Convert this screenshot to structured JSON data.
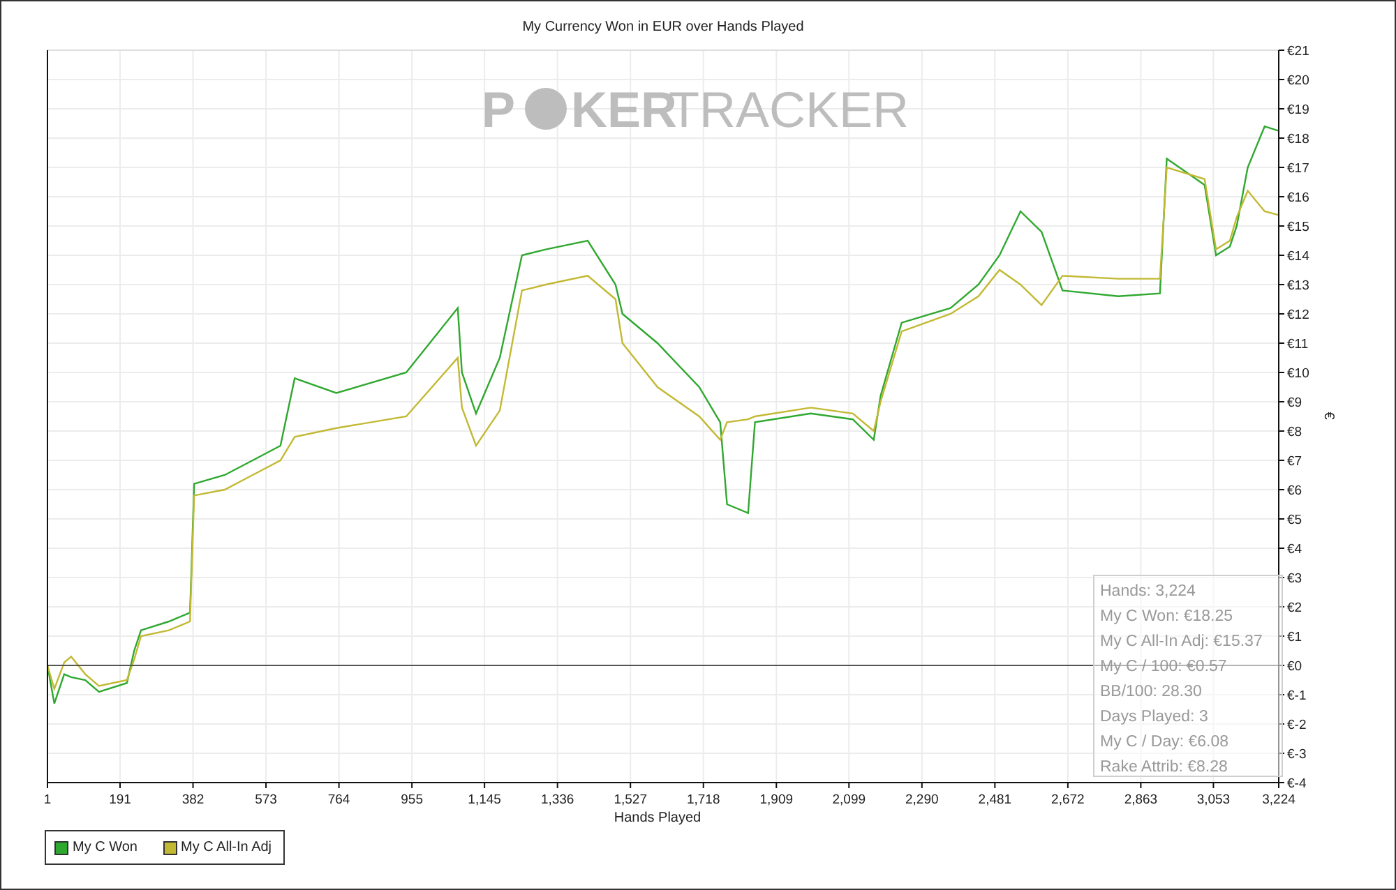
{
  "chart": {
    "logo": {
      "first": "P",
      "bold": "KER",
      "light": "TRACKER"
    },
    "chart_data": {
      "type": "line",
      "title": "My Currency Won in EUR over Hands Played",
      "xlabel": "Hands Played",
      "ylabel": "€",
      "x": [
        1,
        19,
        45,
        63,
        100,
        136,
        209,
        228,
        246,
        319,
        374,
        385,
        465,
        538,
        611,
        648,
        757,
        940,
        1075,
        1086,
        1123,
        1185,
        1243,
        1305,
        1415,
        1488,
        1506,
        1598,
        1707,
        1762,
        1780,
        1835,
        1853,
        1999,
        2109,
        2164,
        2182,
        2237,
        2365,
        2438,
        2493,
        2548,
        2603,
        2658,
        2804,
        2913,
        2931,
        3030,
        3060,
        3096,
        3114,
        3143,
        3187,
        3224
      ],
      "series": [
        {
          "name": "My C Won",
          "color": "#2fa82f",
          "values": [
            0,
            -1.3,
            -0.3,
            -0.4,
            -0.5,
            -0.9,
            -0.6,
            0.5,
            1.2,
            1.5,
            1.8,
            6.2,
            6.5,
            7,
            7.5,
            9.8,
            9.3,
            10,
            12.2,
            10,
            8.6,
            10.5,
            14,
            14.2,
            14.5,
            13,
            12,
            11,
            9.5,
            8.3,
            5.5,
            5.2,
            8.3,
            8.6,
            8.4,
            7.7,
            9.2,
            11.7,
            12.2,
            13,
            14,
            15.5,
            14.8,
            12.8,
            12.6,
            12.7,
            17.3,
            16.4,
            14,
            14.3,
            15,
            17,
            18.4,
            18.25
          ]
        },
        {
          "name": "My C All-In Adj",
          "color": "#c2b933",
          "values": [
            0,
            -0.8,
            0.1,
            0.3,
            -0.3,
            -0.7,
            -0.5,
            0.2,
            1,
            1.2,
            1.5,
            5.8,
            6,
            6.5,
            7,
            7.8,
            8.1,
            8.5,
            10.5,
            8.8,
            7.5,
            8.7,
            12.8,
            13,
            13.3,
            12.5,
            11,
            9.5,
            8.5,
            7.7,
            8.3,
            8.4,
            8.5,
            8.8,
            8.6,
            8,
            9,
            11.4,
            12,
            12.6,
            13.5,
            13,
            12.3,
            13.3,
            13.2,
            13.2,
            17,
            16.6,
            14.2,
            14.5,
            15.3,
            16.2,
            15.5,
            15.37
          ]
        }
      ],
      "grid": true,
      "xlim": [
        1,
        3224
      ],
      "ylim": [
        -4,
        21
      ],
      "xticks": [
        {
          "value": 1,
          "label": "1"
        },
        {
          "value": 191,
          "label": "191"
        },
        {
          "value": 382,
          "label": "382"
        },
        {
          "value": 573,
          "label": "573"
        },
        {
          "value": 764,
          "label": "764"
        },
        {
          "value": 955,
          "label": "955"
        },
        {
          "value": 1145,
          "label": "1,145"
        },
        {
          "value": 1336,
          "label": "1,336"
        },
        {
          "value": 1527,
          "label": "1,527"
        },
        {
          "value": 1718,
          "label": "1,718"
        },
        {
          "value": 1909,
          "label": "1,909"
        },
        {
          "value": 2099,
          "label": "2,099"
        },
        {
          "value": 2290,
          "label": "2,290"
        },
        {
          "value": 2481,
          "label": "2,481"
        },
        {
          "value": 2672,
          "label": "2,672"
        },
        {
          "value": 2863,
          "label": "2,863"
        },
        {
          "value": 3053,
          "label": "3,053"
        },
        {
          "value": 3224,
          "label": "3,224"
        }
      ],
      "yticks": [
        {
          "value": -4,
          "label": "€-4"
        },
        {
          "value": -3,
          "label": "€-3"
        },
        {
          "value": -2,
          "label": "€-2"
        },
        {
          "value": -1,
          "label": "€-1"
        },
        {
          "value": 0,
          "label": "€0"
        },
        {
          "value": 1,
          "label": "€1"
        },
        {
          "value": 2,
          "label": "€2"
        },
        {
          "value": 3,
          "label": "€3"
        },
        {
          "value": 4,
          "label": "€4"
        },
        {
          "value": 5,
          "label": "€5"
        },
        {
          "value": 6,
          "label": "€6"
        },
        {
          "value": 7,
          "label": "€7"
        },
        {
          "value": 8,
          "label": "€8"
        },
        {
          "value": 9,
          "label": "€9"
        },
        {
          "value": 10,
          "label": "€10"
        },
        {
          "value": 11,
          "label": "€11"
        },
        {
          "value": 12,
          "label": "€12"
        },
        {
          "value": 13,
          "label": "€13"
        },
        {
          "value": 14,
          "label": "€14"
        },
        {
          "value": 15,
          "label": "€15"
        },
        {
          "value": 16,
          "label": "€16"
        },
        {
          "value": 17,
          "label": "€17"
        },
        {
          "value": 18,
          "label": "€18"
        },
        {
          "value": 19,
          "label": "€19"
        },
        {
          "value": 20,
          "label": "€20"
        },
        {
          "value": 21,
          "label": "€21"
        }
      ]
    },
    "stats": [
      "Hands: 3,224",
      "My C Won: €18.25",
      "My C All-In Adj: €15.37",
      "My C / 100: €0.57",
      "BB/100: 28.30",
      "Days Played: 3",
      "My C / Day: €6.08",
      "Rake Attrib: €8.28"
    ]
  }
}
